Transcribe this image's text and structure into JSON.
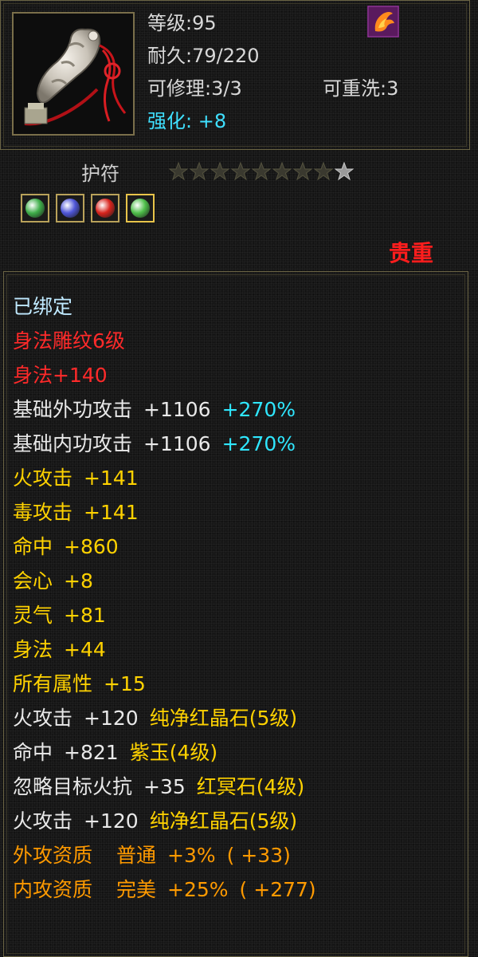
{
  "colors": {
    "frame": "#6b6444",
    "stat_text": "#d8d8d8",
    "refine": "#3fe0ff",
    "rarity": "#ff1d1d",
    "bound": "#bfe9ff",
    "red": "#ff2a2a",
    "yellow": "#ffd200",
    "cyan": "#2fe7ff",
    "orange": "#ff9a00"
  },
  "header": {
    "item_icon": "jade-amulet-icon",
    "badge_icon": "phoenix-flame-icon",
    "level": "等级:95",
    "durability": "耐久:79/220",
    "repairable": "可修理:3/3",
    "rewashable": "可重洗:3",
    "refine_label": "强化:",
    "refine_value": "+8"
  },
  "item": {
    "type": "护符",
    "stars_filled": 8,
    "stars_total": 9,
    "gems": [
      {
        "icon": "gem-green-icon",
        "color": "#3fae4a",
        "lit": false
      },
      {
        "icon": "gem-blue-icon",
        "color": "#4f56d8",
        "lit": false
      },
      {
        "icon": "gem-red-icon",
        "color": "#d8241d",
        "lit": false
      },
      {
        "icon": "gem-green-icon",
        "color": "#4fbf4a",
        "lit": true
      }
    ],
    "rarity": "贵重"
  },
  "details": {
    "bound": "已绑定",
    "carving": "身法雕纹6级",
    "agility_bonus": "身法+140",
    "base_ext_attack": {
      "label": "基础外功攻击",
      "value": "+1106",
      "percent": "+270%"
    },
    "base_int_attack": {
      "label": "基础内功攻击",
      "value": "+1106",
      "percent": "+270%"
    },
    "attrs": [
      {
        "label": "火攻击",
        "value": "+141"
      },
      {
        "label": "毒攻击",
        "value": "+141"
      },
      {
        "label": "命中",
        "value": "+860"
      },
      {
        "label": "会心",
        "value": "+8"
      },
      {
        "label": "灵气",
        "value": "+81"
      },
      {
        "label": "身法",
        "value": "+44"
      },
      {
        "label": "所有属性",
        "value": "+15"
      }
    ],
    "gem_lines": [
      {
        "label": "火攻击",
        "value": "+120",
        "gem": "纯净红晶石",
        "level": "(5级)"
      },
      {
        "label": "命中",
        "value": "+821",
        "gem": "紫玉",
        "level": "(4级)"
      },
      {
        "label": "忽略目标火抗",
        "value": "+35",
        "gem": "红冥石",
        "level": "(4级)"
      },
      {
        "label": "火攻击",
        "value": "+120",
        "gem": "纯净红晶石",
        "level": "(5级)"
      }
    ],
    "aptitudes": [
      {
        "label": "外攻资质",
        "grade": "普通",
        "value": "+3%",
        "extra": "( +33)"
      },
      {
        "label": "内攻资质",
        "grade": "完美",
        "value": "+25%",
        "extra": "( +277)"
      }
    ]
  }
}
